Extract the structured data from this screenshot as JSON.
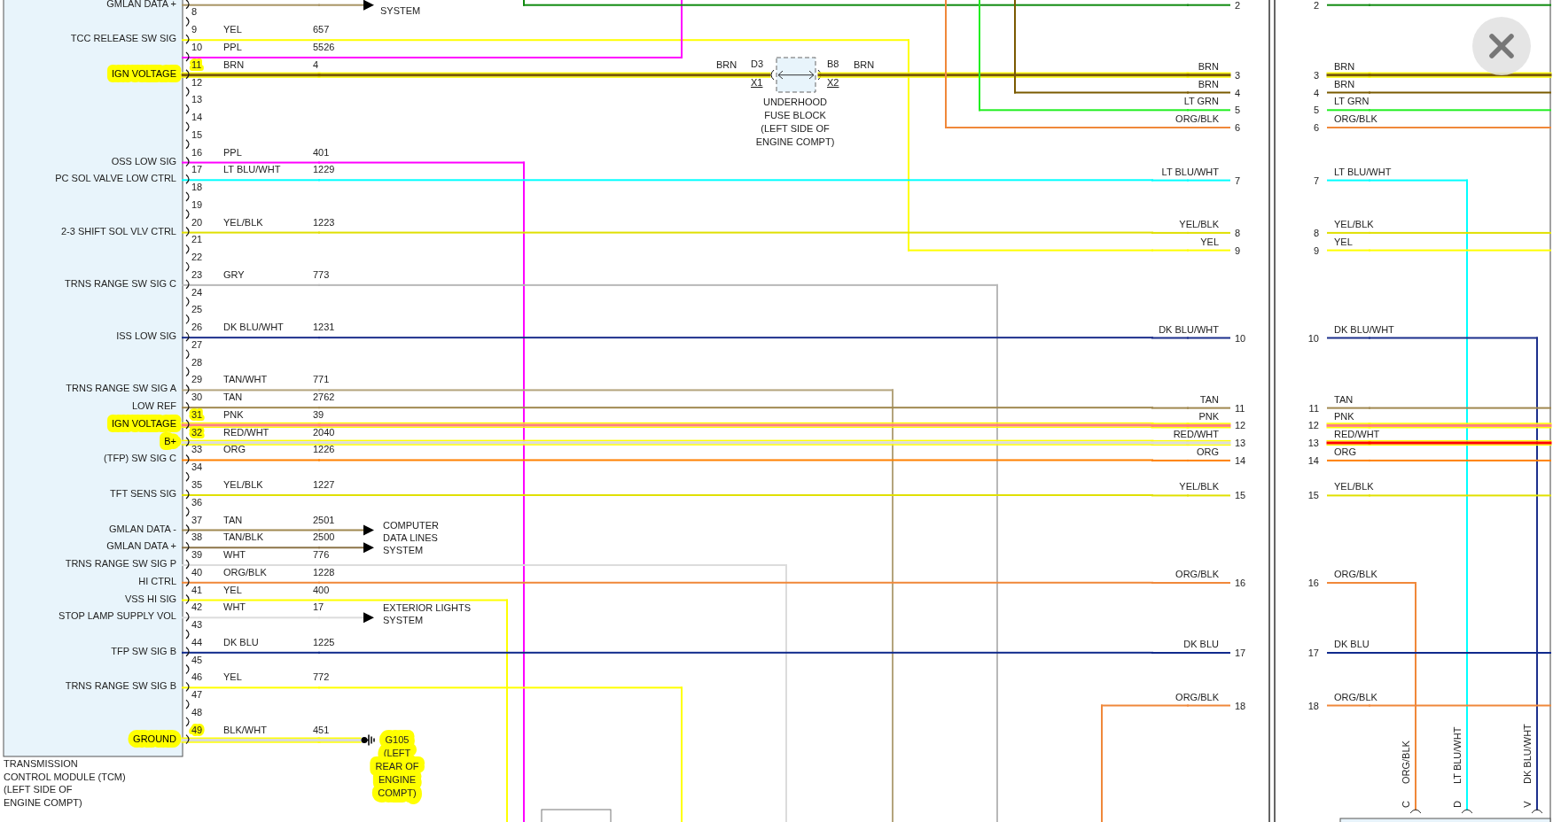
{
  "module": {
    "caption": [
      "TRANSMISSION",
      "CONTROL MODULE (TCM)",
      "(LEFT SIDE OF",
      "ENGINE COMPT)"
    ]
  },
  "pins": [
    {
      "label": "GMLAN DATA +",
      "color": "#a89464",
      "highlighted": false
    },
    {
      "number": "8",
      "highlighted": false
    },
    {
      "number": "9",
      "label": "TCC RELEASE SW SIG",
      "wire": "YEL",
      "circuit": "657",
      "color": "#ffff00",
      "highlighted": false
    },
    {
      "number": "10",
      "wire": "PPL",
      "circuit": "5526",
      "color": "#ff00ff",
      "highlighted": false
    },
    {
      "number": "11",
      "label": "IGN VOLTAGE",
      "wire": "BRN",
      "circuit": "4",
      "color": "#7a5a00",
      "highlighted": true
    },
    {
      "number": "12",
      "highlighted": false
    },
    {
      "number": "13",
      "highlighted": false
    },
    {
      "number": "14",
      "highlighted": false
    },
    {
      "number": "15",
      "highlighted": false
    },
    {
      "number": "16",
      "label": "OSS LOW SIG",
      "wire": "PPL",
      "circuit": "401",
      "color": "#ff00ff",
      "highlighted": false
    },
    {
      "number": "17",
      "label": "PC SOL VALVE LOW CTRL",
      "wire": "LT BLU/WHT",
      "circuit": "1229",
      "color": "#00ffff",
      "highlighted": false
    },
    {
      "number": "18",
      "highlighted": false
    },
    {
      "number": "19",
      "highlighted": false
    },
    {
      "number": "20",
      "label": "2-3 SHIFT SOL VLV CTRL",
      "wire": "YEL/BLK",
      "circuit": "1223",
      "color": "#e0e000",
      "highlighted": false
    },
    {
      "number": "21",
      "highlighted": false
    },
    {
      "number": "22",
      "highlighted": false
    },
    {
      "number": "23",
      "label": "TRNS RANGE SW SIG C",
      "wire": "GRY",
      "circuit": "773",
      "color": "#b8b8b8",
      "highlighted": false
    },
    {
      "number": "24",
      "highlighted": false
    },
    {
      "number": "25",
      "highlighted": false
    },
    {
      "number": "26",
      "label": "ISS LOW SIG",
      "wire": "DK BLU/WHT",
      "circuit": "1231",
      "color": "#1c2f8c",
      "highlighted": false
    },
    {
      "number": "27",
      "highlighted": false
    },
    {
      "number": "28",
      "highlighted": false
    },
    {
      "number": "29",
      "label": "TRNS RANGE SW SIG A",
      "wire": "TAN/WHT",
      "circuit": "771",
      "color": "#b4a47c",
      "highlighted": false
    },
    {
      "number": "30",
      "label": "LOW REF",
      "wire": "TAN",
      "circuit": "2762",
      "color": "#a08850",
      "highlighted": false
    },
    {
      "number": "31",
      "label": "IGN VOLTAGE",
      "wire": "PNK",
      "circuit": "39",
      "color": "#ff8080",
      "highlighted": true
    },
    {
      "number": "32",
      "label": "B+",
      "wire": "RED/WHT",
      "circuit": "2040",
      "color": "#dcdcdc",
      "highlighted": true
    },
    {
      "number": "33",
      "label": "(TFP) SW SIG C",
      "wire": "ORG",
      "circuit": "1226",
      "color": "#ff8000",
      "highlighted": false
    },
    {
      "number": "34",
      "highlighted": false
    },
    {
      "number": "35",
      "label": "TFT SENS SIG",
      "wire": "YEL/BLK",
      "circuit": "1227",
      "color": "#e0e000",
      "highlighted": false
    },
    {
      "number": "36",
      "highlighted": false
    },
    {
      "number": "37",
      "label": "GMLAN DATA -",
      "wire": "TAN",
      "circuit": "2501",
      "color": "#a08850",
      "highlighted": false
    },
    {
      "number": "38",
      "label": "GMLAN DATA +",
      "wire": "TAN/BLK",
      "circuit": "2500",
      "color": "#8c7448",
      "highlighted": false
    },
    {
      "number": "39",
      "label": "TRNS RANGE SW SIG P",
      "wire": "WHT",
      "circuit": "776",
      "color": "#dcdcdc",
      "highlighted": false
    },
    {
      "number": "40",
      "label": "HI CTRL",
      "wire": "ORG/BLK",
      "circuit": "1228",
      "color": "#f0883a",
      "highlighted": false
    },
    {
      "number": "41",
      "label": "VSS HI SIG",
      "wire": "YEL",
      "circuit": "400",
      "color": "#ffff00",
      "highlighted": false
    },
    {
      "number": "42",
      "label": "STOP LAMP SUPPLY VOL",
      "wire": "WHT",
      "circuit": "17",
      "color": "#dcdcdc",
      "highlighted": false
    },
    {
      "number": "43",
      "highlighted": false
    },
    {
      "number": "44",
      "label": "TFP SW SIG B",
      "wire": "DK BLU",
      "circuit": "1225",
      "color": "#102a8c",
      "highlighted": false
    },
    {
      "number": "45",
      "highlighted": false
    },
    {
      "number": "46",
      "label": "TRNS RANGE SW SIG B",
      "wire": "YEL",
      "circuit": "772",
      "color": "#ffff00",
      "highlighted": false
    },
    {
      "number": "47",
      "highlighted": false
    },
    {
      "number": "48",
      "highlighted": false
    },
    {
      "number": "49",
      "label": "GROUND",
      "wire": "BLK/WHT",
      "circuit": "451",
      "color": "#d8d8d8",
      "highlighted": true
    }
  ],
  "destinations": [
    {
      "caption": [
        "SYSTEM"
      ]
    },
    {
      "caption": [
        "COMPUTER",
        "DATA LINES",
        "SYSTEM"
      ]
    },
    {
      "caption": [
        "EXTERIOR LIGHTS",
        "SYSTEM"
      ]
    }
  ],
  "ground": {
    "caption": [
      "G105",
      "(LEFT",
      "REAR OF",
      "ENGINE",
      "COMPT)"
    ],
    "highlighted": true
  },
  "fuse_block": {
    "left_wire": "BRN",
    "left_cavity": "D3",
    "left_connector": "X1",
    "right_cavity": "B8",
    "right_connector": "X2",
    "right_wire": "BRN",
    "caption": [
      "UNDERHOOD",
      "FUSE BLOCK",
      "(LEFT SIDE OF",
      "ENGINE COMPT)"
    ]
  },
  "harness_left": [
    {
      "number": "2",
      "color": "#108a10",
      "highlighted": false
    },
    {
      "number": "3",
      "label": "BRN",
      "color": "#7a5a00",
      "highlighted": true
    },
    {
      "number": "4",
      "label": "BRN",
      "color": "#7a5a00",
      "highlighted": false
    },
    {
      "number": "5",
      "label": "LT GRN",
      "color": "#22ee22",
      "highlighted": false
    },
    {
      "number": "6",
      "label": "ORG/BLK",
      "color": "#f0883a",
      "highlighted": false
    },
    {
      "number": "7",
      "label": "LT BLU/WHT",
      "color": "#00ffff",
      "highlighted": false
    },
    {
      "number": "8",
      "label": "YEL/BLK",
      "color": "#e0e000",
      "highlighted": false
    },
    {
      "number": "9",
      "label": "YEL",
      "color": "#ffff00",
      "highlighted": false
    },
    {
      "number": "10",
      "label": "DK BLU/WHT",
      "color": "#1c2f8c",
      "highlighted": false
    },
    {
      "number": "11",
      "label": "TAN",
      "color": "#a08850",
      "highlighted": false
    },
    {
      "number": "12",
      "label": "PNK",
      "color": "#ff8080",
      "highlighted": true
    },
    {
      "number": "13",
      "label": "RED/WHT",
      "color": "#dcdcdc",
      "highlighted": true
    },
    {
      "number": "14",
      "label": "ORG",
      "color": "#ff8000",
      "highlighted": false
    },
    {
      "number": "15",
      "label": "YEL/BLK",
      "color": "#e0e000",
      "highlighted": false
    },
    {
      "number": "16",
      "label": "ORG/BLK",
      "color": "#f0883a",
      "highlighted": false
    },
    {
      "number": "17",
      "label": "DK BLU",
      "color": "#102a8c",
      "highlighted": false
    },
    {
      "number": "18",
      "label": "ORG/BLK",
      "color": "#f0883a",
      "highlighted": false
    }
  ],
  "harness_right": [
    {
      "number": "2",
      "color": "#108a10",
      "highlighted": false
    },
    {
      "number": "3",
      "label": "BRN",
      "color": "#7a5a00",
      "highlighted": true
    },
    {
      "number": "4",
      "label": "BRN",
      "color": "#7a5a00",
      "highlighted": false
    },
    {
      "number": "5",
      "label": "LT GRN",
      "color": "#22ee22",
      "highlighted": false
    },
    {
      "number": "6",
      "label": "ORG/BLK",
      "color": "#f0883a",
      "highlighted": false
    },
    {
      "number": "7",
      "label": "LT BLU/WHT",
      "color": "#00ffff",
      "highlighted": false
    },
    {
      "number": "8",
      "label": "YEL/BLK",
      "color": "#e0e000",
      "highlighted": false
    },
    {
      "number": "9",
      "label": "YEL",
      "color": "#ffff00",
      "highlighted": false
    },
    {
      "number": "10",
      "label": "DK BLU/WHT",
      "color": "#1c2f8c",
      "highlighted": false
    },
    {
      "number": "11",
      "label": "TAN",
      "color": "#a08850",
      "highlighted": false
    },
    {
      "number": "12",
      "label": "PNK",
      "color": "#ff8080",
      "highlighted": true
    },
    {
      "number": "13",
      "label": "RED/WHT",
      "color": "#ff0000",
      "highlighted": true
    },
    {
      "number": "14",
      "label": "ORG",
      "color": "#ff8000",
      "highlighted": false
    },
    {
      "number": "15",
      "label": "YEL/BLK",
      "color": "#e0e000",
      "highlighted": false
    },
    {
      "number": "16",
      "label": "ORG/BLK",
      "color": "#f0883a",
      "highlighted": false
    },
    {
      "number": "17",
      "label": "DK BLU",
      "color": "#102a8c",
      "highlighted": false
    },
    {
      "number": "18",
      "label": "ORG/BLK",
      "color": "#f0883a",
      "highlighted": false
    }
  ],
  "bottom_connector": [
    {
      "cavity": "C",
      "wire": "ORG/BLK"
    },
    {
      "cavity": "D",
      "wire": "LT BLU/WHT"
    },
    {
      "cavity": "V",
      "wire": "DK BLU/WHT"
    }
  ]
}
